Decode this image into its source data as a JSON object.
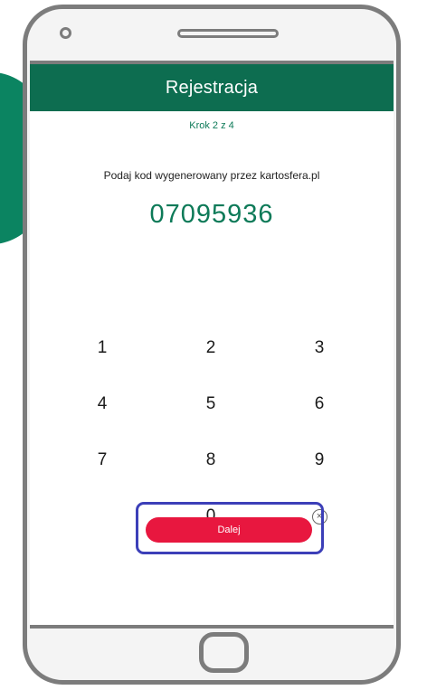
{
  "header": {
    "title": "Rejestracja"
  },
  "step_indicator": "Krok 2 z 4",
  "instruction": "Podaj kod wygenerowany przez kartosfera.pl",
  "code": "07095936",
  "keypad": {
    "keys": [
      "1",
      "2",
      "3",
      "4",
      "5",
      "6",
      "7",
      "8",
      "9",
      "",
      "0"
    ],
    "delete_icon": "circle-x-icon",
    "delete_glyph": "×"
  },
  "next_button": {
    "label": "Dalej"
  },
  "colors": {
    "header": "#0d6d50",
    "accent_green": "#0d7a58",
    "button": "#e8173f",
    "highlight": "#3c3fb8",
    "device_frame": "#7c7c7c"
  }
}
